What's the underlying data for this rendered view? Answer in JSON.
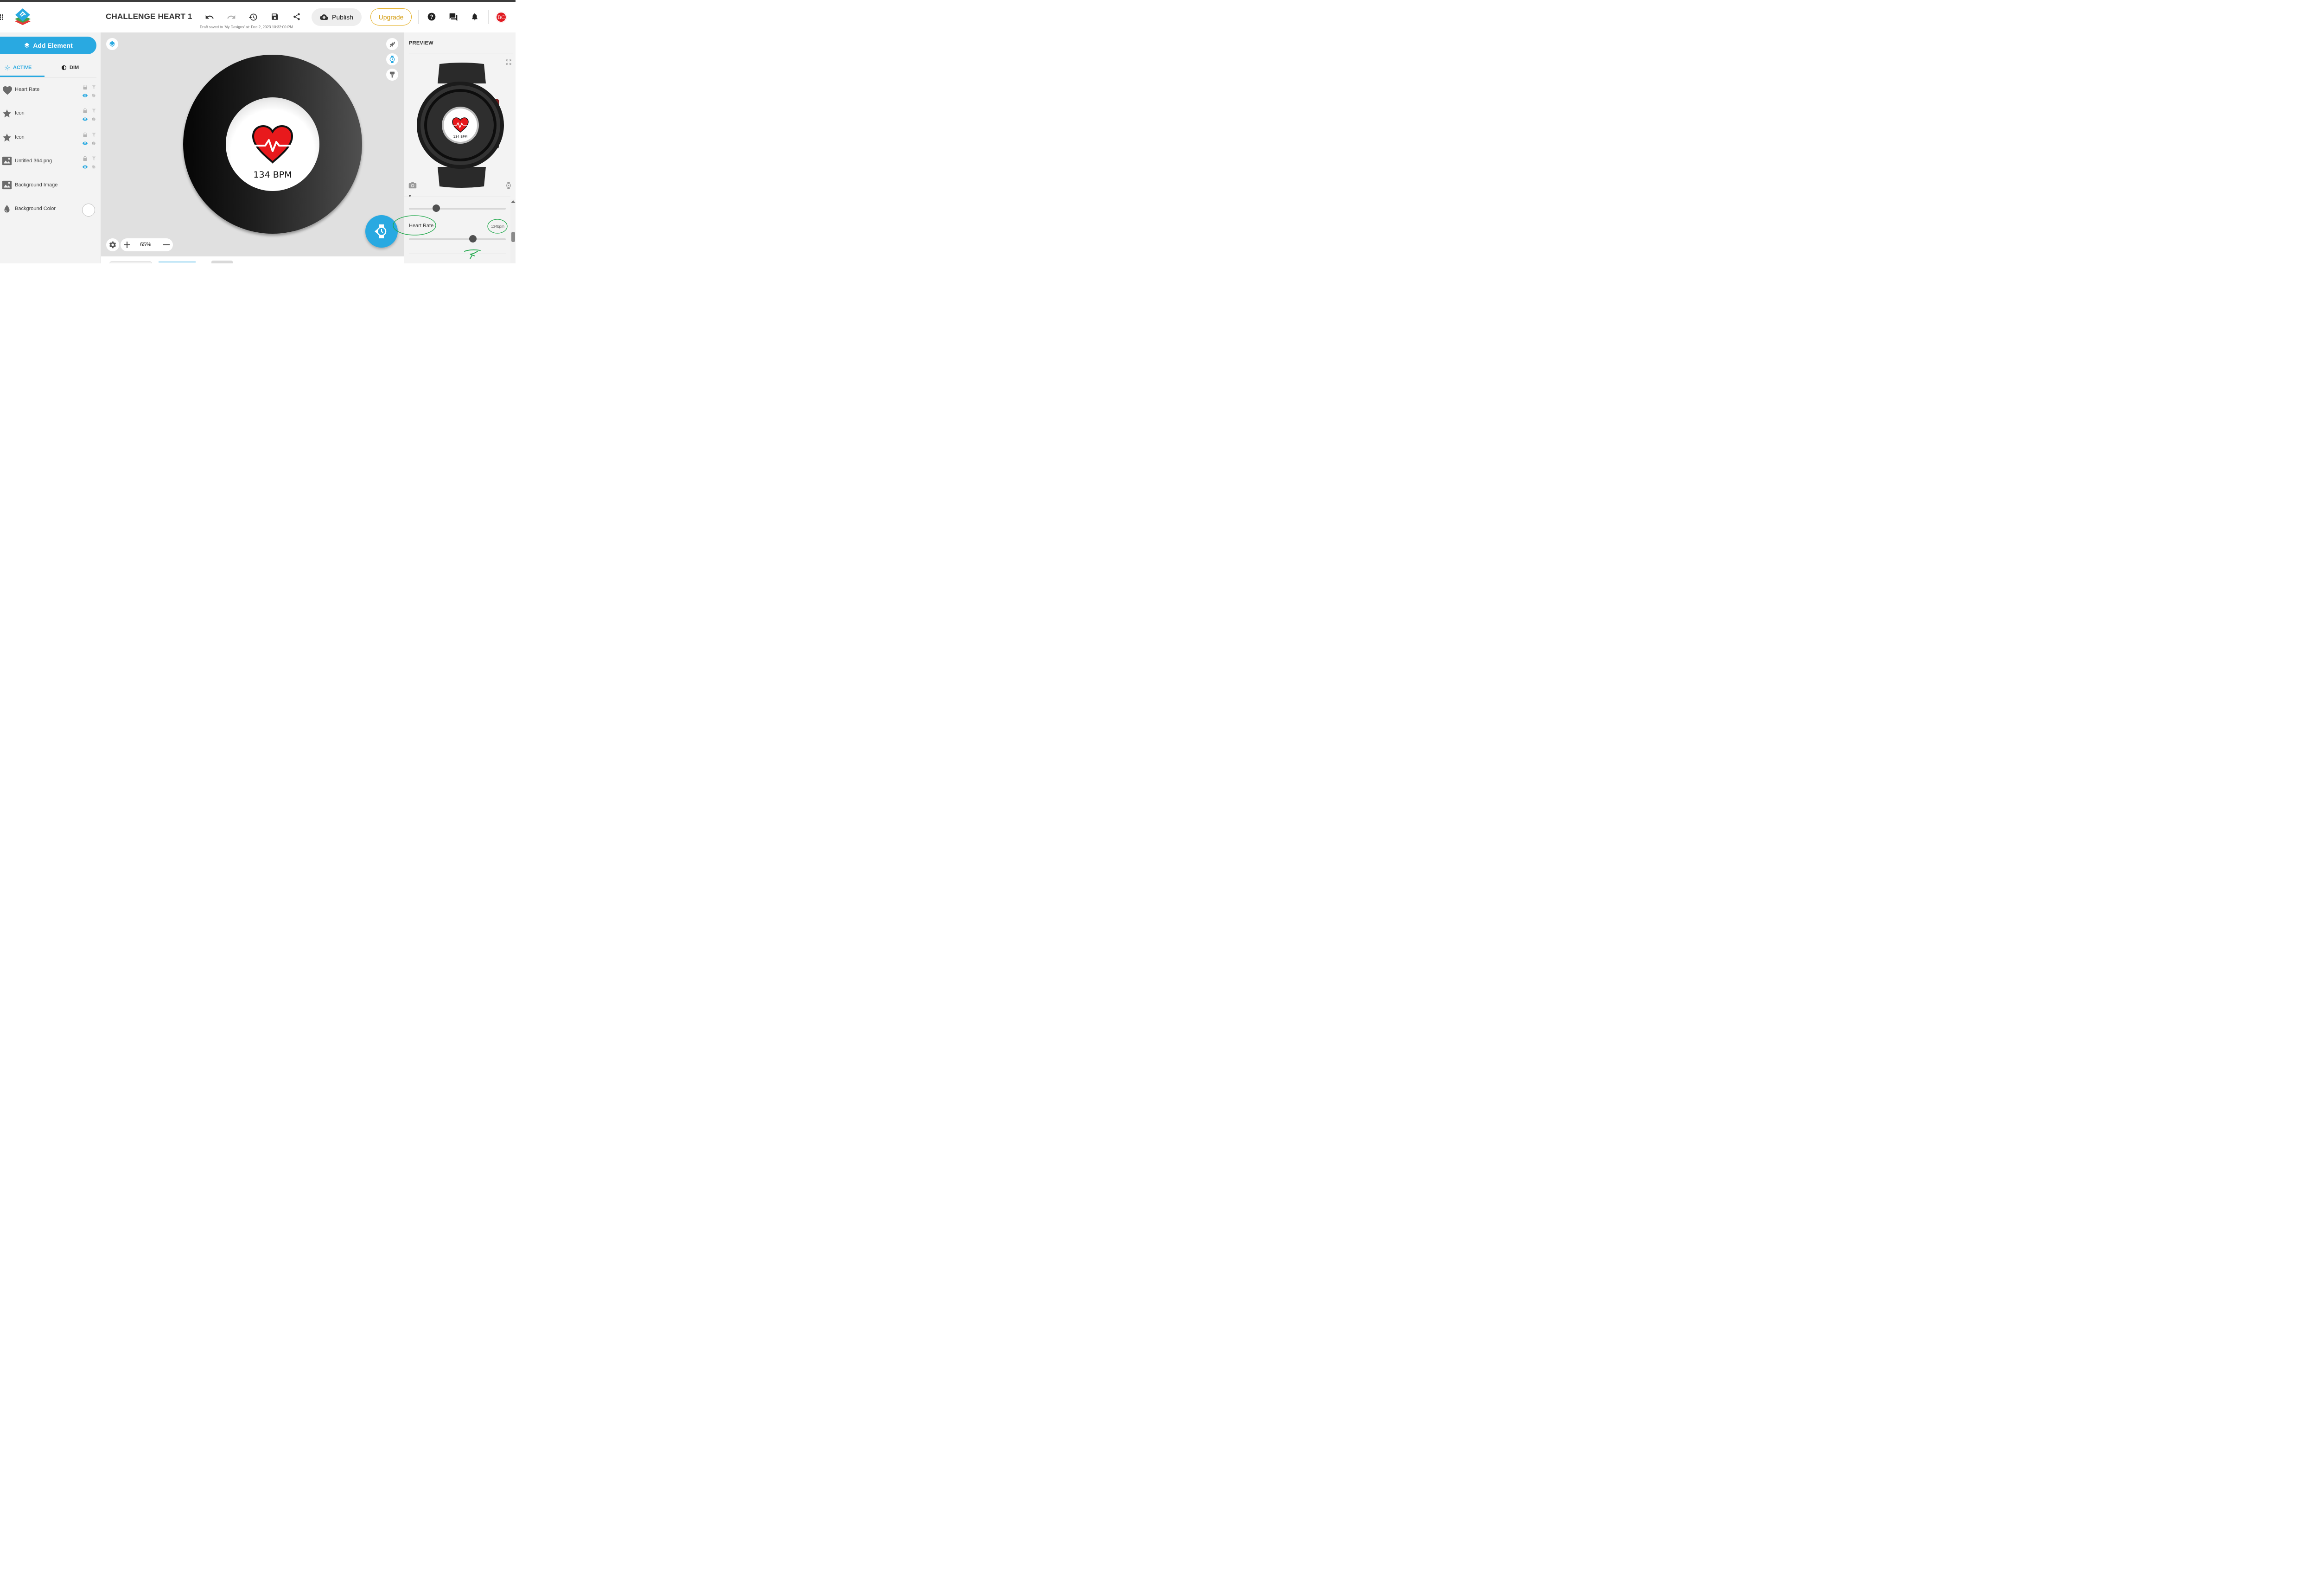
{
  "header": {
    "title": "CHALLENGE HEART 1",
    "draft_status": "Draft saved to 'My Designs' at: Dec 2, 2023 10:32:00 PM",
    "publish_label": "Publish",
    "upgrade_label": "Upgrade",
    "avatar_initials": "BC",
    "toolbar_icons": [
      "undo-icon",
      "redo-icon",
      "history-icon",
      "save-icon",
      "share-icon"
    ],
    "right_icons": [
      "help-icon",
      "chat-icon",
      "bell-icon"
    ]
  },
  "left_panel": {
    "add_element_label": "Add Element",
    "tabs": [
      {
        "label": "ACTIVE",
        "selected": true
      },
      {
        "label": "DIM",
        "selected": false
      }
    ],
    "layers": [
      {
        "label": "Heart Rate",
        "icon": "heart-icon"
      },
      {
        "label": "Icon",
        "icon": "star-icon"
      },
      {
        "label": "Icon",
        "icon": "star-icon"
      },
      {
        "label": "Untitled 364.png",
        "icon": "image-icon"
      },
      {
        "label": "Background Image",
        "icon": "image-icon"
      },
      {
        "label": "Background Color",
        "icon": "droplet-icon"
      }
    ]
  },
  "canvas": {
    "bpm_text": "134 BPM",
    "zoom": "65%"
  },
  "right_panel": {
    "preview_label": "PREVIEW",
    "preview_bpm": "134 BPM",
    "heart_rate_label": "Heart Rate",
    "heart_rate_value": "134bpm",
    "heart_rate_slider_fraction": 0.66,
    "upper_slider_fraction": 0.28
  },
  "colors": {
    "accent": "#29a9e1",
    "upgrade": "#e2a915",
    "heart": "#e8191c",
    "annotation": "#1ea84a",
    "avatar": "#e11b22"
  }
}
